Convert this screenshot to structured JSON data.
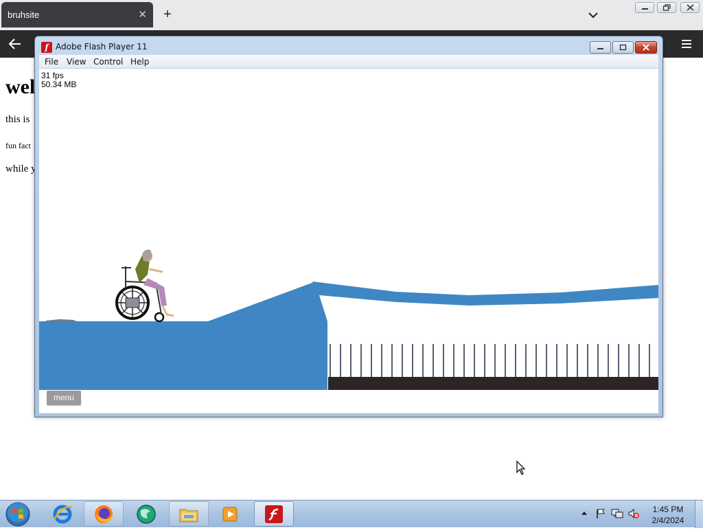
{
  "browser": {
    "tab_title": "bruhsite",
    "tab_close": "✕",
    "new_tab": "+"
  },
  "page": {
    "heading": "wel",
    "line1": "this is",
    "line2": "fun fact",
    "line3": "while y"
  },
  "flash_window": {
    "title": "Adobe Flash Player 11",
    "menu": [
      "File",
      "View",
      "Control",
      "Help"
    ],
    "stats": {
      "fps": "31 fps",
      "memory": "50.34 MB"
    },
    "game_menu_button": "menu",
    "colors": {
      "ground": "#3f87c4",
      "spike_base": "#2c2624",
      "spike": "#5b5f70"
    }
  },
  "taskbar": {
    "items": [
      "internet-explorer",
      "firefox",
      "browser-globe",
      "file-explorer",
      "media-player",
      "adobe-flash"
    ],
    "clock_time": "1:45 PM",
    "clock_date": "2/4/2024"
  }
}
